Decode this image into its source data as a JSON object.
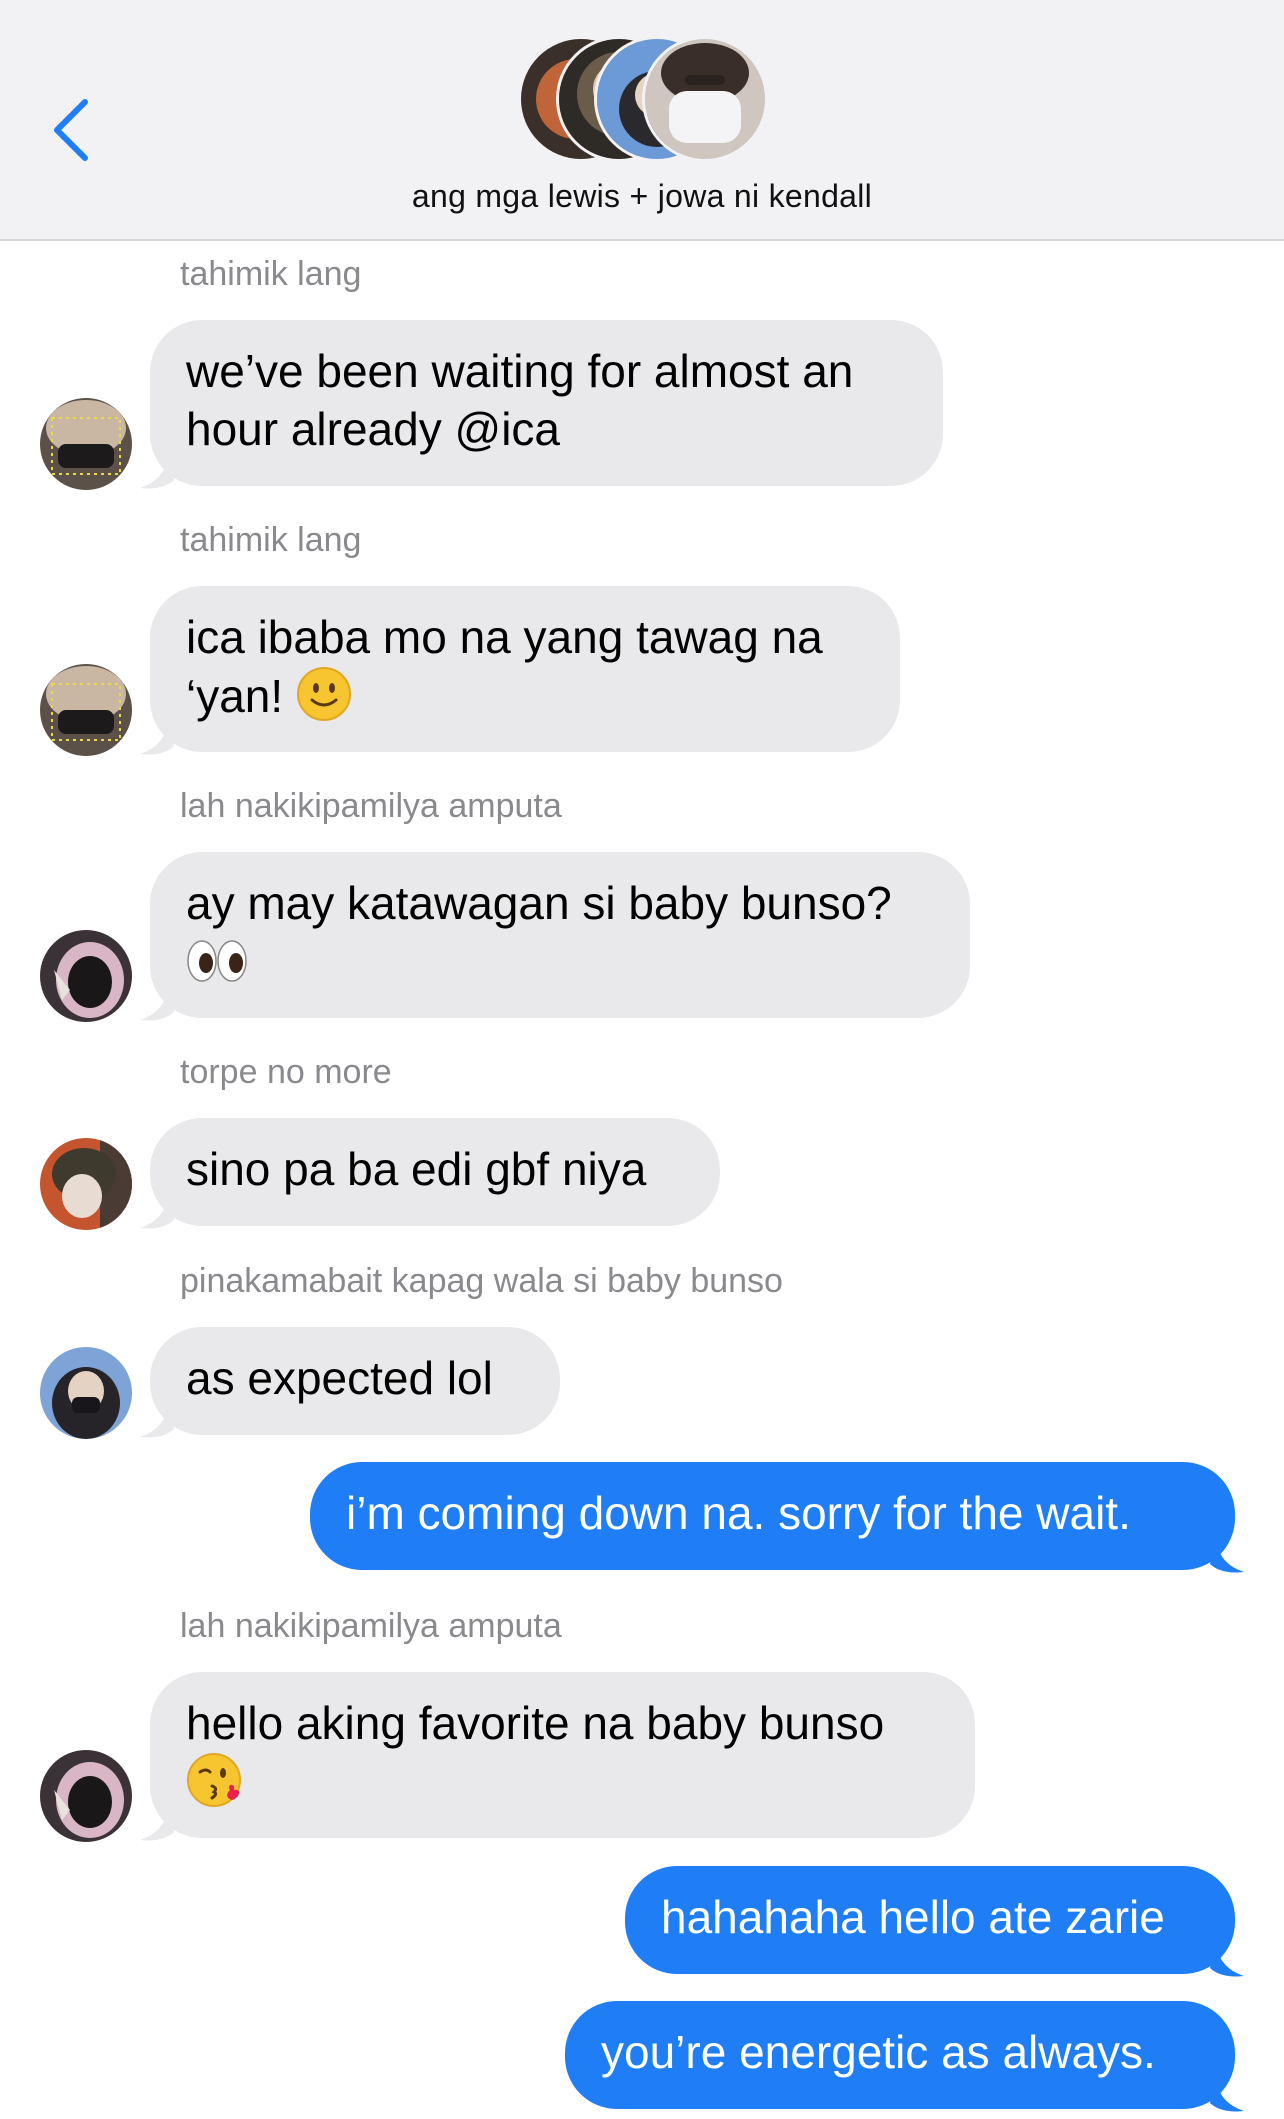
{
  "header": {
    "back_label": "",
    "group_name": "ang mga lewis + jowa ni kendall",
    "avatar_count": 4
  },
  "messages": [
    {
      "type": "in",
      "sender": "tahimik lang",
      "text": "we’ve been waiting for almost an hour already @ica"
    },
    {
      "type": "in",
      "sender": "tahimik lang",
      "text": "ica ibaba mo na yang tawag na ‘yan!",
      "emoji": "slightly-smiling-face"
    },
    {
      "type": "in",
      "sender": "lah nakikipamilya amputa",
      "text": "ay may katawagan si baby bunso?",
      "emoji": "eyes"
    },
    {
      "type": "in",
      "sender": "torpe no more",
      "text": "sino pa ba edi gbf niya"
    },
    {
      "type": "in",
      "sender": "pinakamabait kapag wala si baby bunso",
      "text": "as expected lol"
    },
    {
      "type": "out",
      "text": "i’m coming down na. sorry for the wait."
    },
    {
      "type": "in",
      "sender": "lah nakikipamilya amputa",
      "text": "hello aking favorite na baby bunso",
      "emoji": "face-blowing-kiss"
    },
    {
      "type": "out",
      "text": "hahahaha hello ate zarie"
    },
    {
      "type": "out",
      "text": "you’re energetic as always."
    }
  ],
  "colors": {
    "header_bg": "#f2f2f4",
    "incoming_bubble": "#e9e9eb",
    "outgoing_bubble": "#1f7ef5",
    "sender_label": "#8a8a8e",
    "back_chevron": "#1f7ef5"
  }
}
